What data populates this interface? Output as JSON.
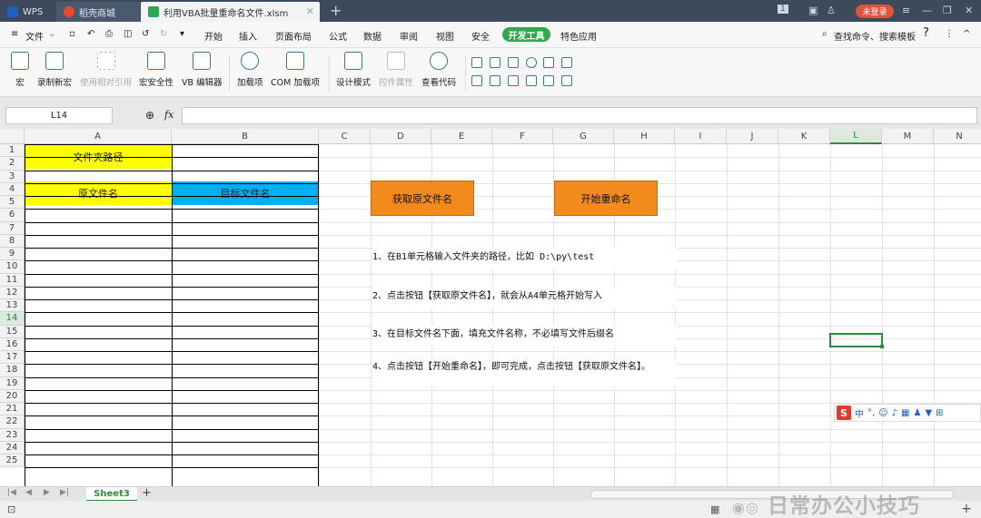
{
  "titlebar": {
    "tabs": [
      {
        "label": "WPS",
        "color": "#1f5fbf"
      },
      {
        "label": "稻壳商城",
        "color": "#e84a2a"
      },
      {
        "label": "利用VBA批量重命名文件.xlsm",
        "color": "#2ea84f"
      }
    ],
    "new_tab": "+",
    "page_count": "1",
    "login": "未登录"
  },
  "menubar": {
    "file": "文件",
    "items": [
      "开始",
      "插入",
      "页面布局",
      "公式",
      "数据",
      "审阅",
      "视图",
      "安全"
    ],
    "dev_tab": "开发工具",
    "special": "特色应用",
    "search": "查找命令、搜索模板",
    "help": "?",
    "more": "⋮",
    "collapse": "^"
  },
  "ribbon": {
    "buttons": [
      {
        "label": "宏",
        "enabled": true
      },
      {
        "label": "录制新宏",
        "enabled": true
      },
      {
        "label": "使用相对引用",
        "enabled": false
      },
      {
        "label": "宏安全性",
        "enabled": true
      },
      {
        "label": "VB 编辑器",
        "enabled": true
      },
      {
        "label": "加载项",
        "enabled": true
      },
      {
        "label": "COM 加载项",
        "enabled": true
      },
      {
        "label": "设计模式",
        "enabled": true
      },
      {
        "label": "控件属性",
        "enabled": false
      },
      {
        "label": "查看代码",
        "enabled": true
      }
    ]
  },
  "formula_bar": {
    "name_box": "L14",
    "fx": "fx",
    "content": ""
  },
  "columns": [
    "A",
    "B",
    "C",
    "D",
    "E",
    "F",
    "G",
    "H",
    "I",
    "J",
    "K",
    "L",
    "M",
    "N"
  ],
  "selected_column": "L",
  "rows": [
    "1",
    "2",
    "3",
    "4",
    "5",
    "6",
    "7",
    "8",
    "9",
    "10",
    "11",
    "12",
    "13",
    "14",
    "15",
    "16",
    "17",
    "18",
    "19",
    "20",
    "21",
    "22",
    "23",
    "24",
    "25"
  ],
  "selected_row": "14",
  "cells": {
    "a1": "文件夹路径",
    "a3": "原文件名",
    "b3": "目标文件名",
    "a1_color": "#ffff00",
    "a3_color": "#ffff00",
    "b3_color": "#00b0f0"
  },
  "vba_buttons": {
    "get_names": "获取原文件名",
    "rename": "开始重命名",
    "color": "#f28a1c"
  },
  "notes": [
    "1、在B1单元格输入文件夹的路径，比如 D:\\py\\test",
    "2、点击按钮【获取原文件名】，就会从A4单元格开始写入",
    "3、在目标文件名下面，填充文件名称，不必填写文件后缀名",
    "4、点击按钮【开始重命名】，即可完成，点击按钮【获取原文件名】。"
  ],
  "ime_bar": {
    "logo": "S",
    "lang": "中",
    "punct": "°,"
  },
  "sheet_tabs": {
    "active": "Sheet3",
    "add": "+"
  },
  "watermark": "日常办公小技巧"
}
